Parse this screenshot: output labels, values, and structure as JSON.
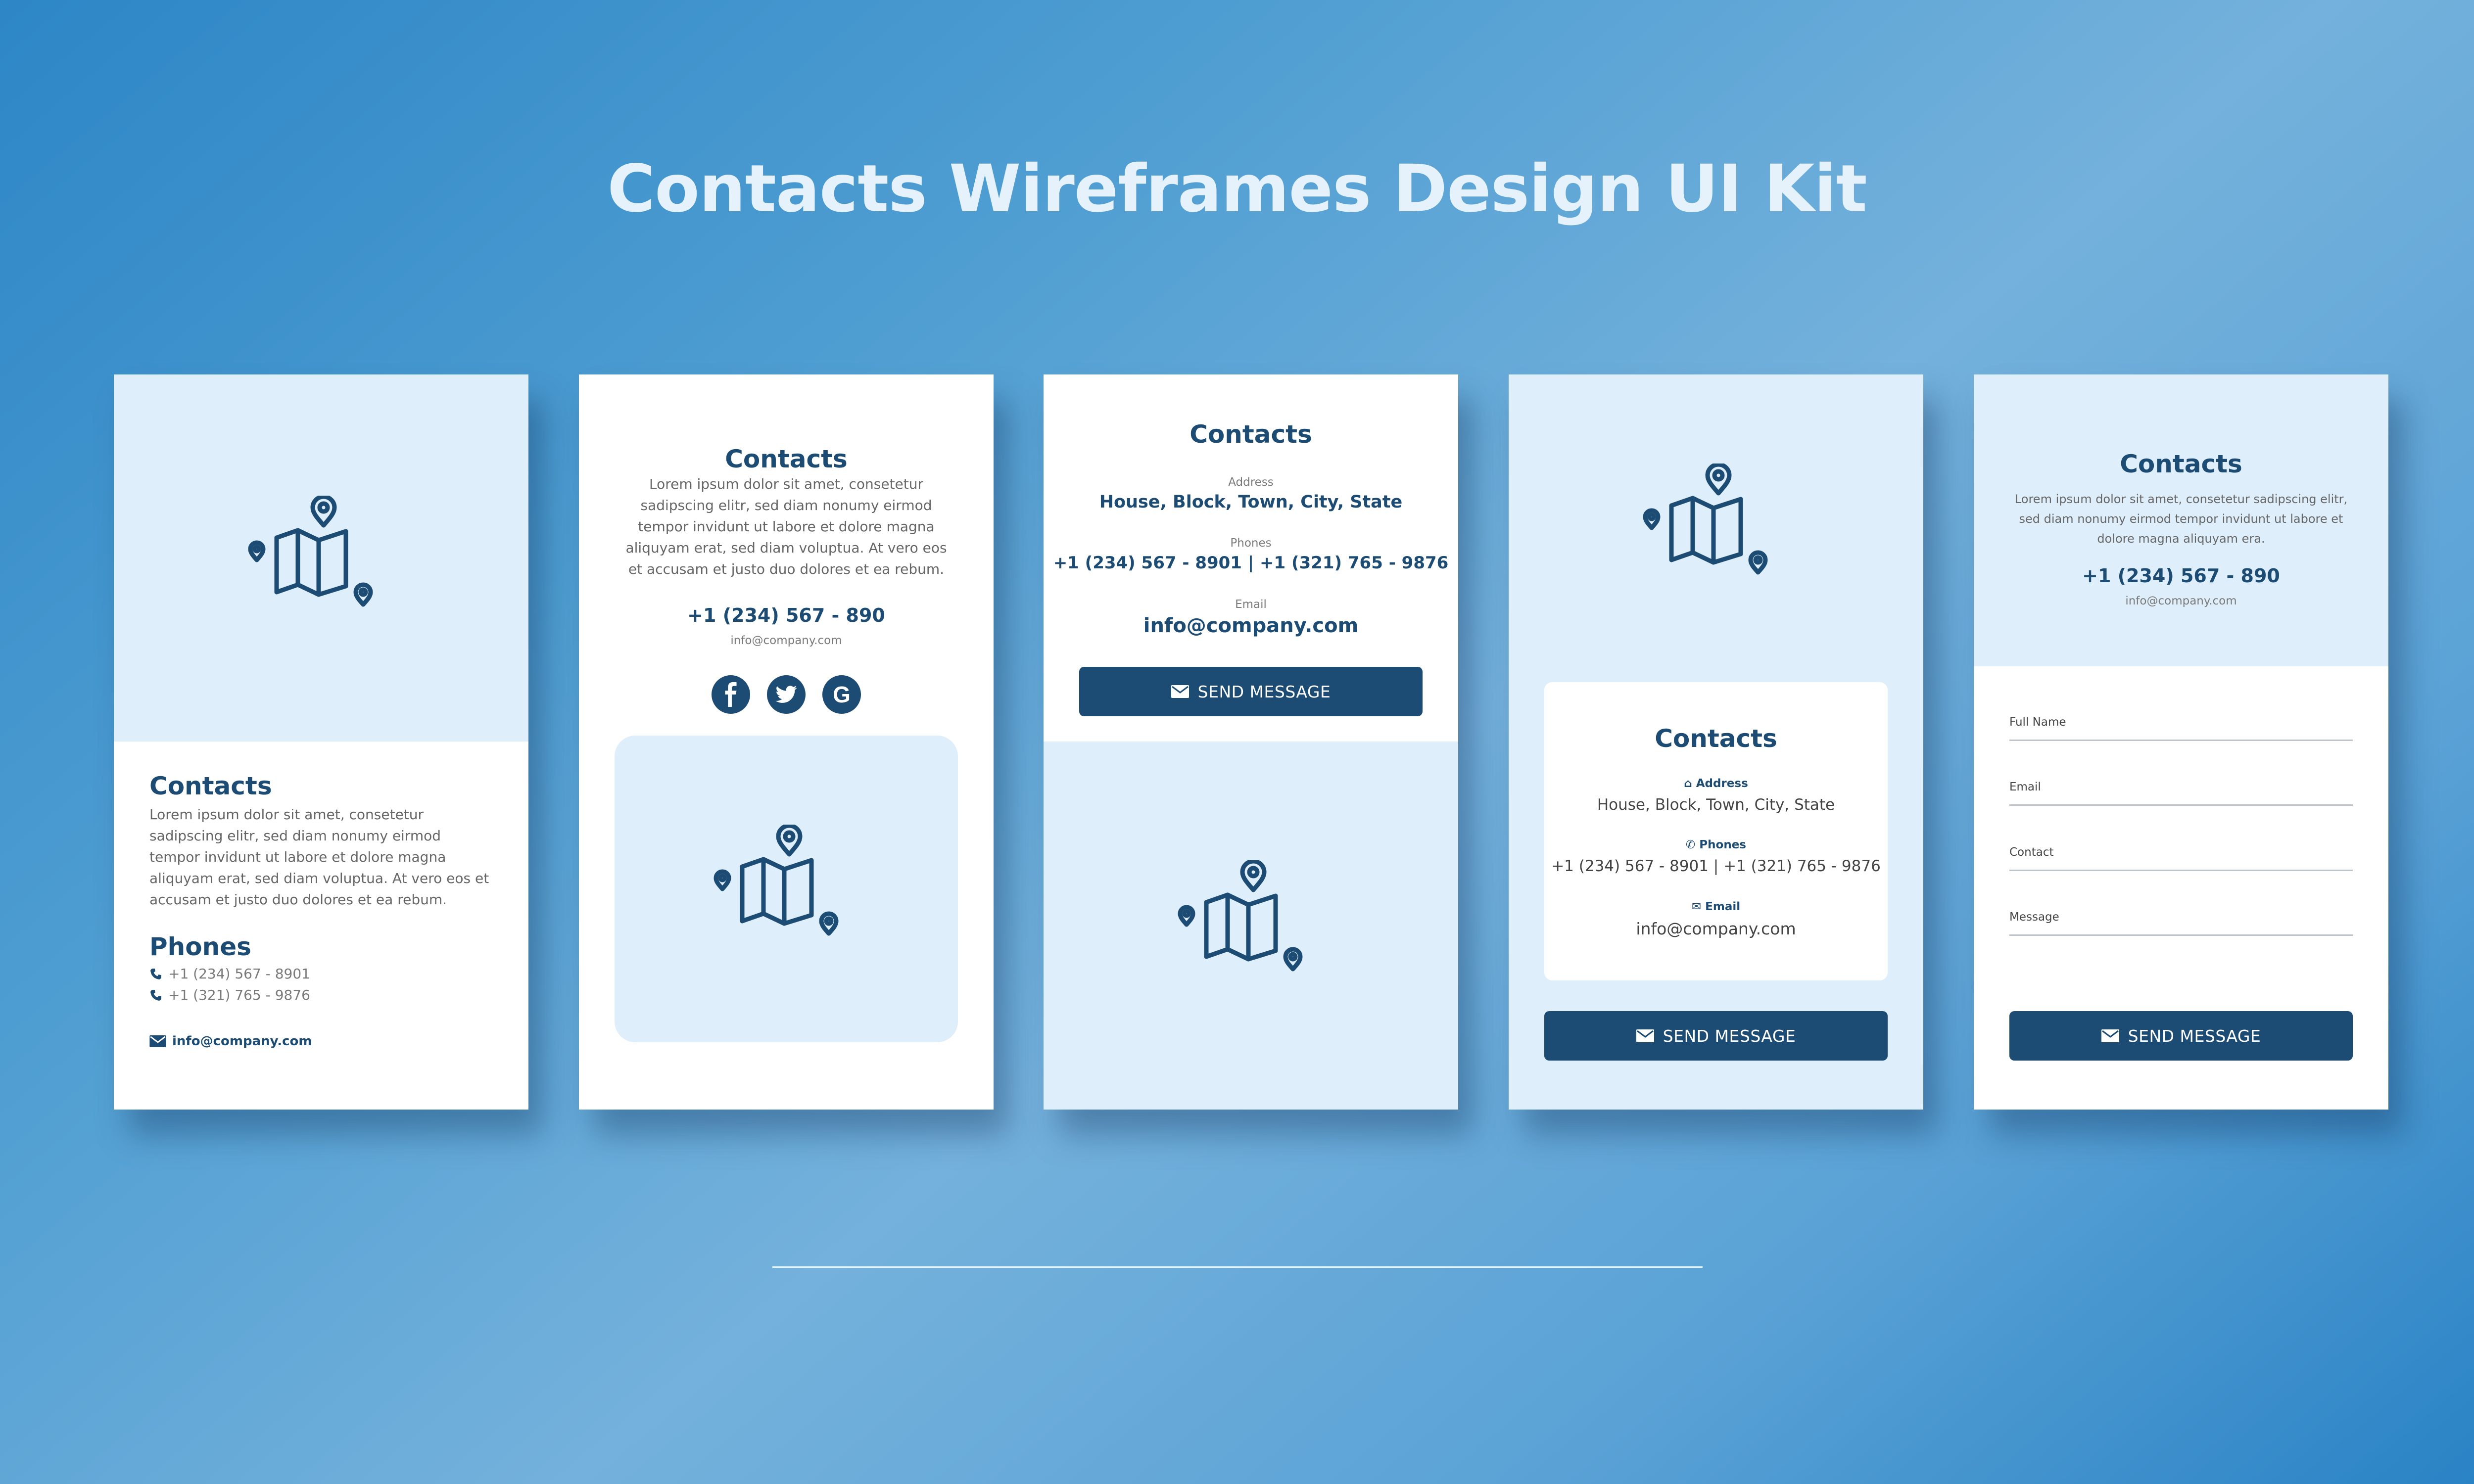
{
  "page_title": "Contacts Wireframes Design UI Kit",
  "colors": {
    "primary": "#1c4b73",
    "light_panel": "#deeefa",
    "title": "#e5f2fc"
  },
  "card1": {
    "title": "Contacts",
    "body": "Lorem ipsum dolor sit amet, consetetur sadipscing elitr, sed diam nonumy eirmod tempor invidunt ut labore et dolore magna aliquyam erat, sed diam voluptua. At vero eos et accusam et justo duo dolores et ea rebum.",
    "phones_title": "Phones",
    "phone1": "+1 (234) 567 - 8901",
    "phone2": "+1 (321) 765 - 9876",
    "email": "info@company.com"
  },
  "card2": {
    "title": "Contacts",
    "body": "Lorem ipsum dolor sit amet, consetetur sadipscing elitr, sed diam nonumy eirmod tempor invidunt ut labore et dolore magna aliquyam erat, sed diam voluptua. At vero eos et accusam et justo duo dolores et ea rebum.",
    "phone": "+1 (234) 567 - 890",
    "email": "info@company.com",
    "social": [
      "facebook-icon",
      "twitter-icon",
      "google-icon"
    ]
  },
  "card3": {
    "title": "Contacts",
    "address_label": "Address",
    "address": "House, Block, Town, City, State",
    "phones_label": "Phones",
    "phones": "+1 (234) 567 - 8901 | +1 (321) 765 - 9876",
    "email_label": "Email",
    "email": "info@company.com",
    "button": "SEND MESSAGE"
  },
  "card4": {
    "title": "Contacts",
    "address_label": "Address",
    "address": "House, Block, Town, City, State",
    "phones_label": "Phones",
    "phones": "+1 (234) 567 - 8901 | +1 (321) 765 - 9876",
    "email_label": "Email",
    "email": "info@company.com",
    "button": "SEND MESSAGE"
  },
  "card5": {
    "title": "Contacts",
    "body": "Lorem ipsum dolor sit amet, consetetur sadipscing elitr, sed diam nonumy eirmod tempor invidunt ut labore et dolore magna aliquyam era.",
    "phone": "+1 (234) 567 - 890",
    "email": "info@company.com",
    "fields": [
      "Full Name",
      "Email",
      "Contact",
      "Message"
    ],
    "button": "SEND MESSAGE"
  }
}
